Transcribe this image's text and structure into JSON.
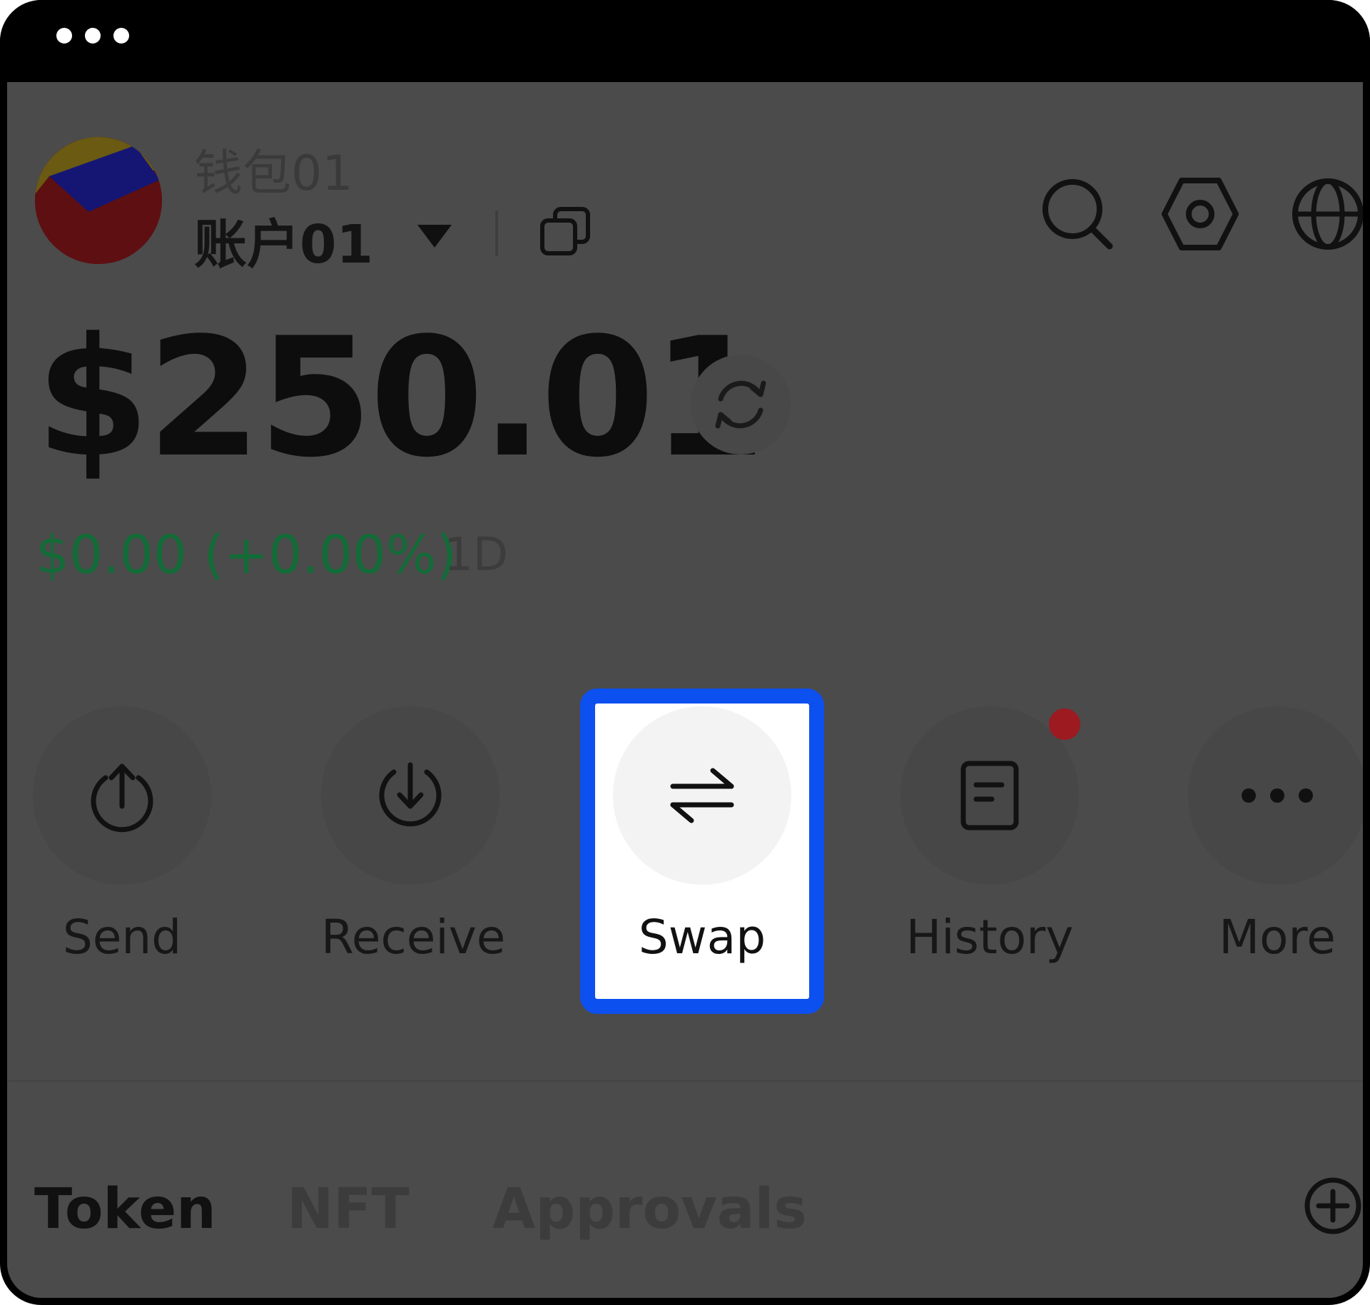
{
  "window": {
    "menu_dots": "•••"
  },
  "header": {
    "wallet_name": "钱包01",
    "account_name": "账户01",
    "icons": [
      "caret-down-icon",
      "copy-icon",
      "search-icon",
      "settings-icon",
      "globe-icon"
    ]
  },
  "balance": {
    "total": "$250.01",
    "change": "$0.00 (+0.00%)",
    "period": "1D",
    "change_color": "#136b38"
  },
  "actions": [
    {
      "label": "Send",
      "icon": "send-icon"
    },
    {
      "label": "Receive",
      "icon": "receive-icon"
    },
    {
      "label": "Swap",
      "icon": "swap-icon",
      "highlighted": true
    },
    {
      "label": "History",
      "icon": "history-icon",
      "notification": true
    },
    {
      "label": "More",
      "icon": "more-icon"
    }
  ],
  "tabs": [
    {
      "label": "Token",
      "active": true
    },
    {
      "label": "NFT"
    },
    {
      "label": "Approvals"
    }
  ],
  "colors": {
    "highlight_border": "#0d50f0",
    "overlay": "#4b4b4b",
    "notification_dot": "#9c1a20"
  }
}
